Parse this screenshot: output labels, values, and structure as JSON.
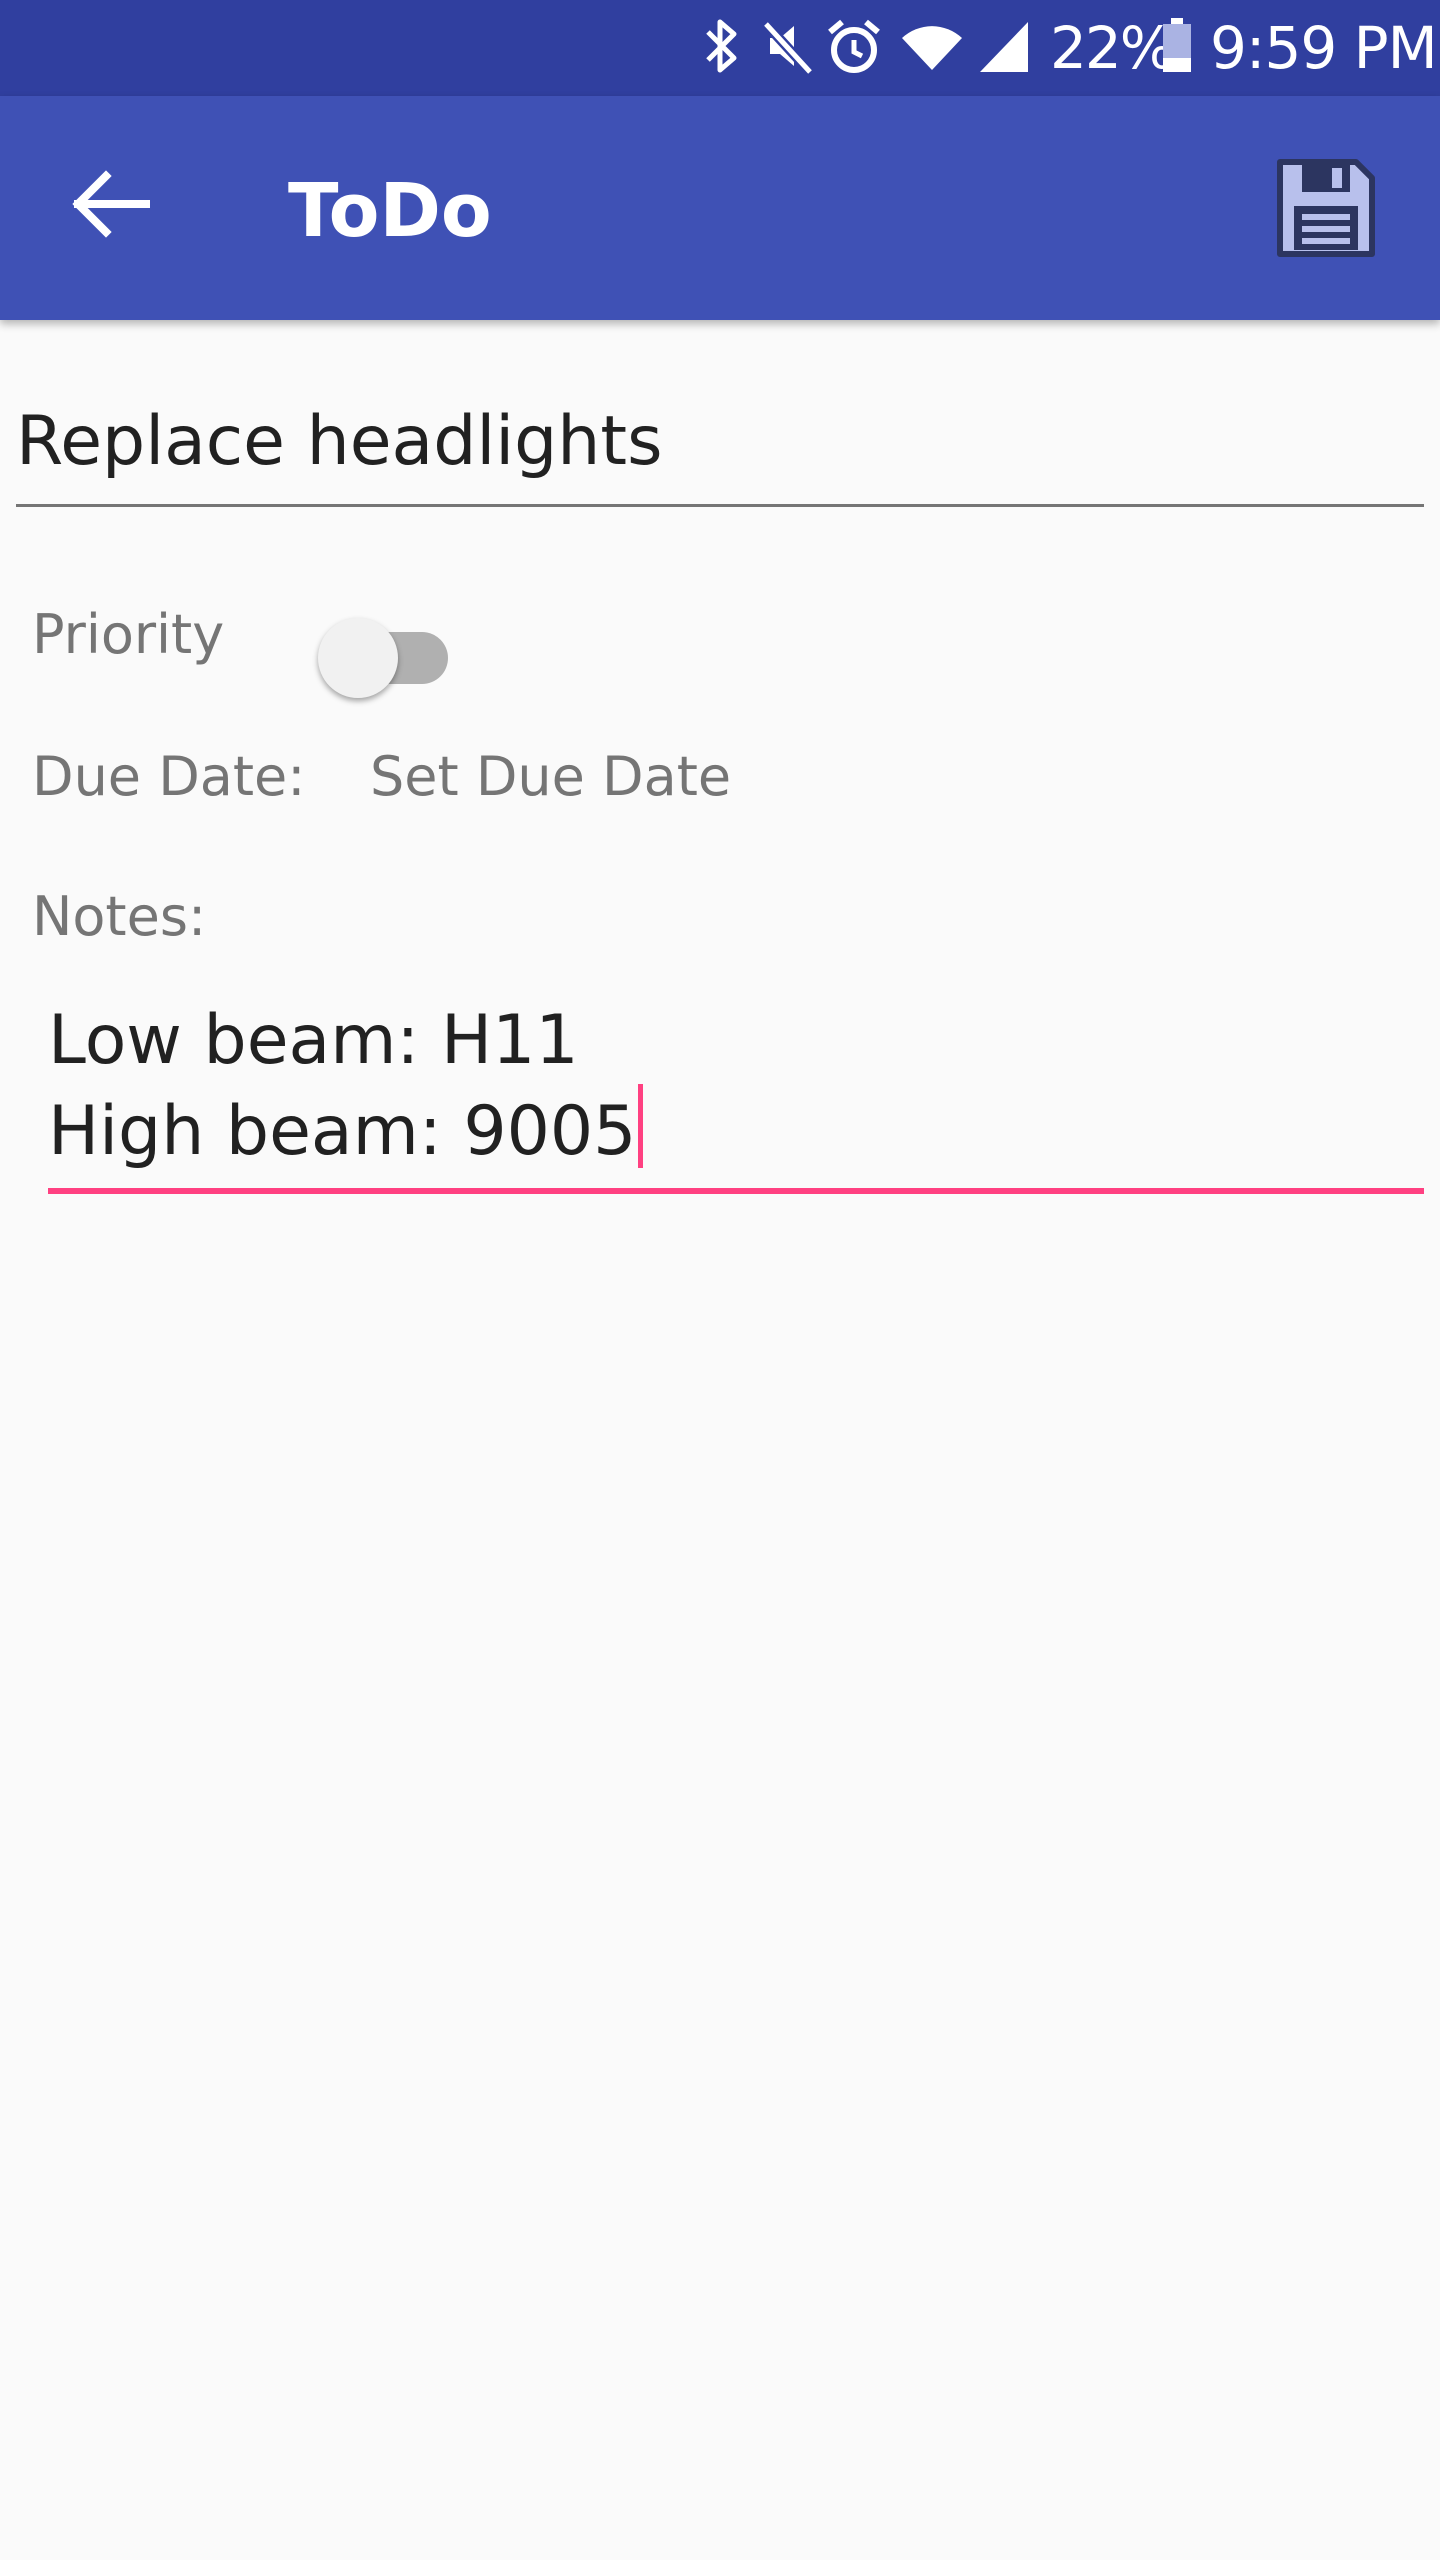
{
  "status_bar": {
    "battery_percent": "22%",
    "time": "9:59 PM",
    "icons": [
      "bluetooth-icon",
      "mute-icon",
      "alarm-icon",
      "wifi-icon",
      "signal-icon",
      "battery-icon"
    ]
  },
  "app_bar": {
    "title": "ToDo",
    "back_icon": "arrow-left-icon",
    "save_icon": "floppy-disk-icon",
    "background": "#3f51b5",
    "status_background": "#303f9f"
  },
  "form": {
    "title_value": "Replace headlights",
    "priority_label": "Priority",
    "priority_enabled": false,
    "due_date_label": "Due Date:",
    "due_date_button": "Set Due Date",
    "notes_label": "Notes:",
    "notes_lines": [
      "Low beam: H11",
      "High beam: 9005"
    ],
    "accent_color": "#ff4081"
  }
}
